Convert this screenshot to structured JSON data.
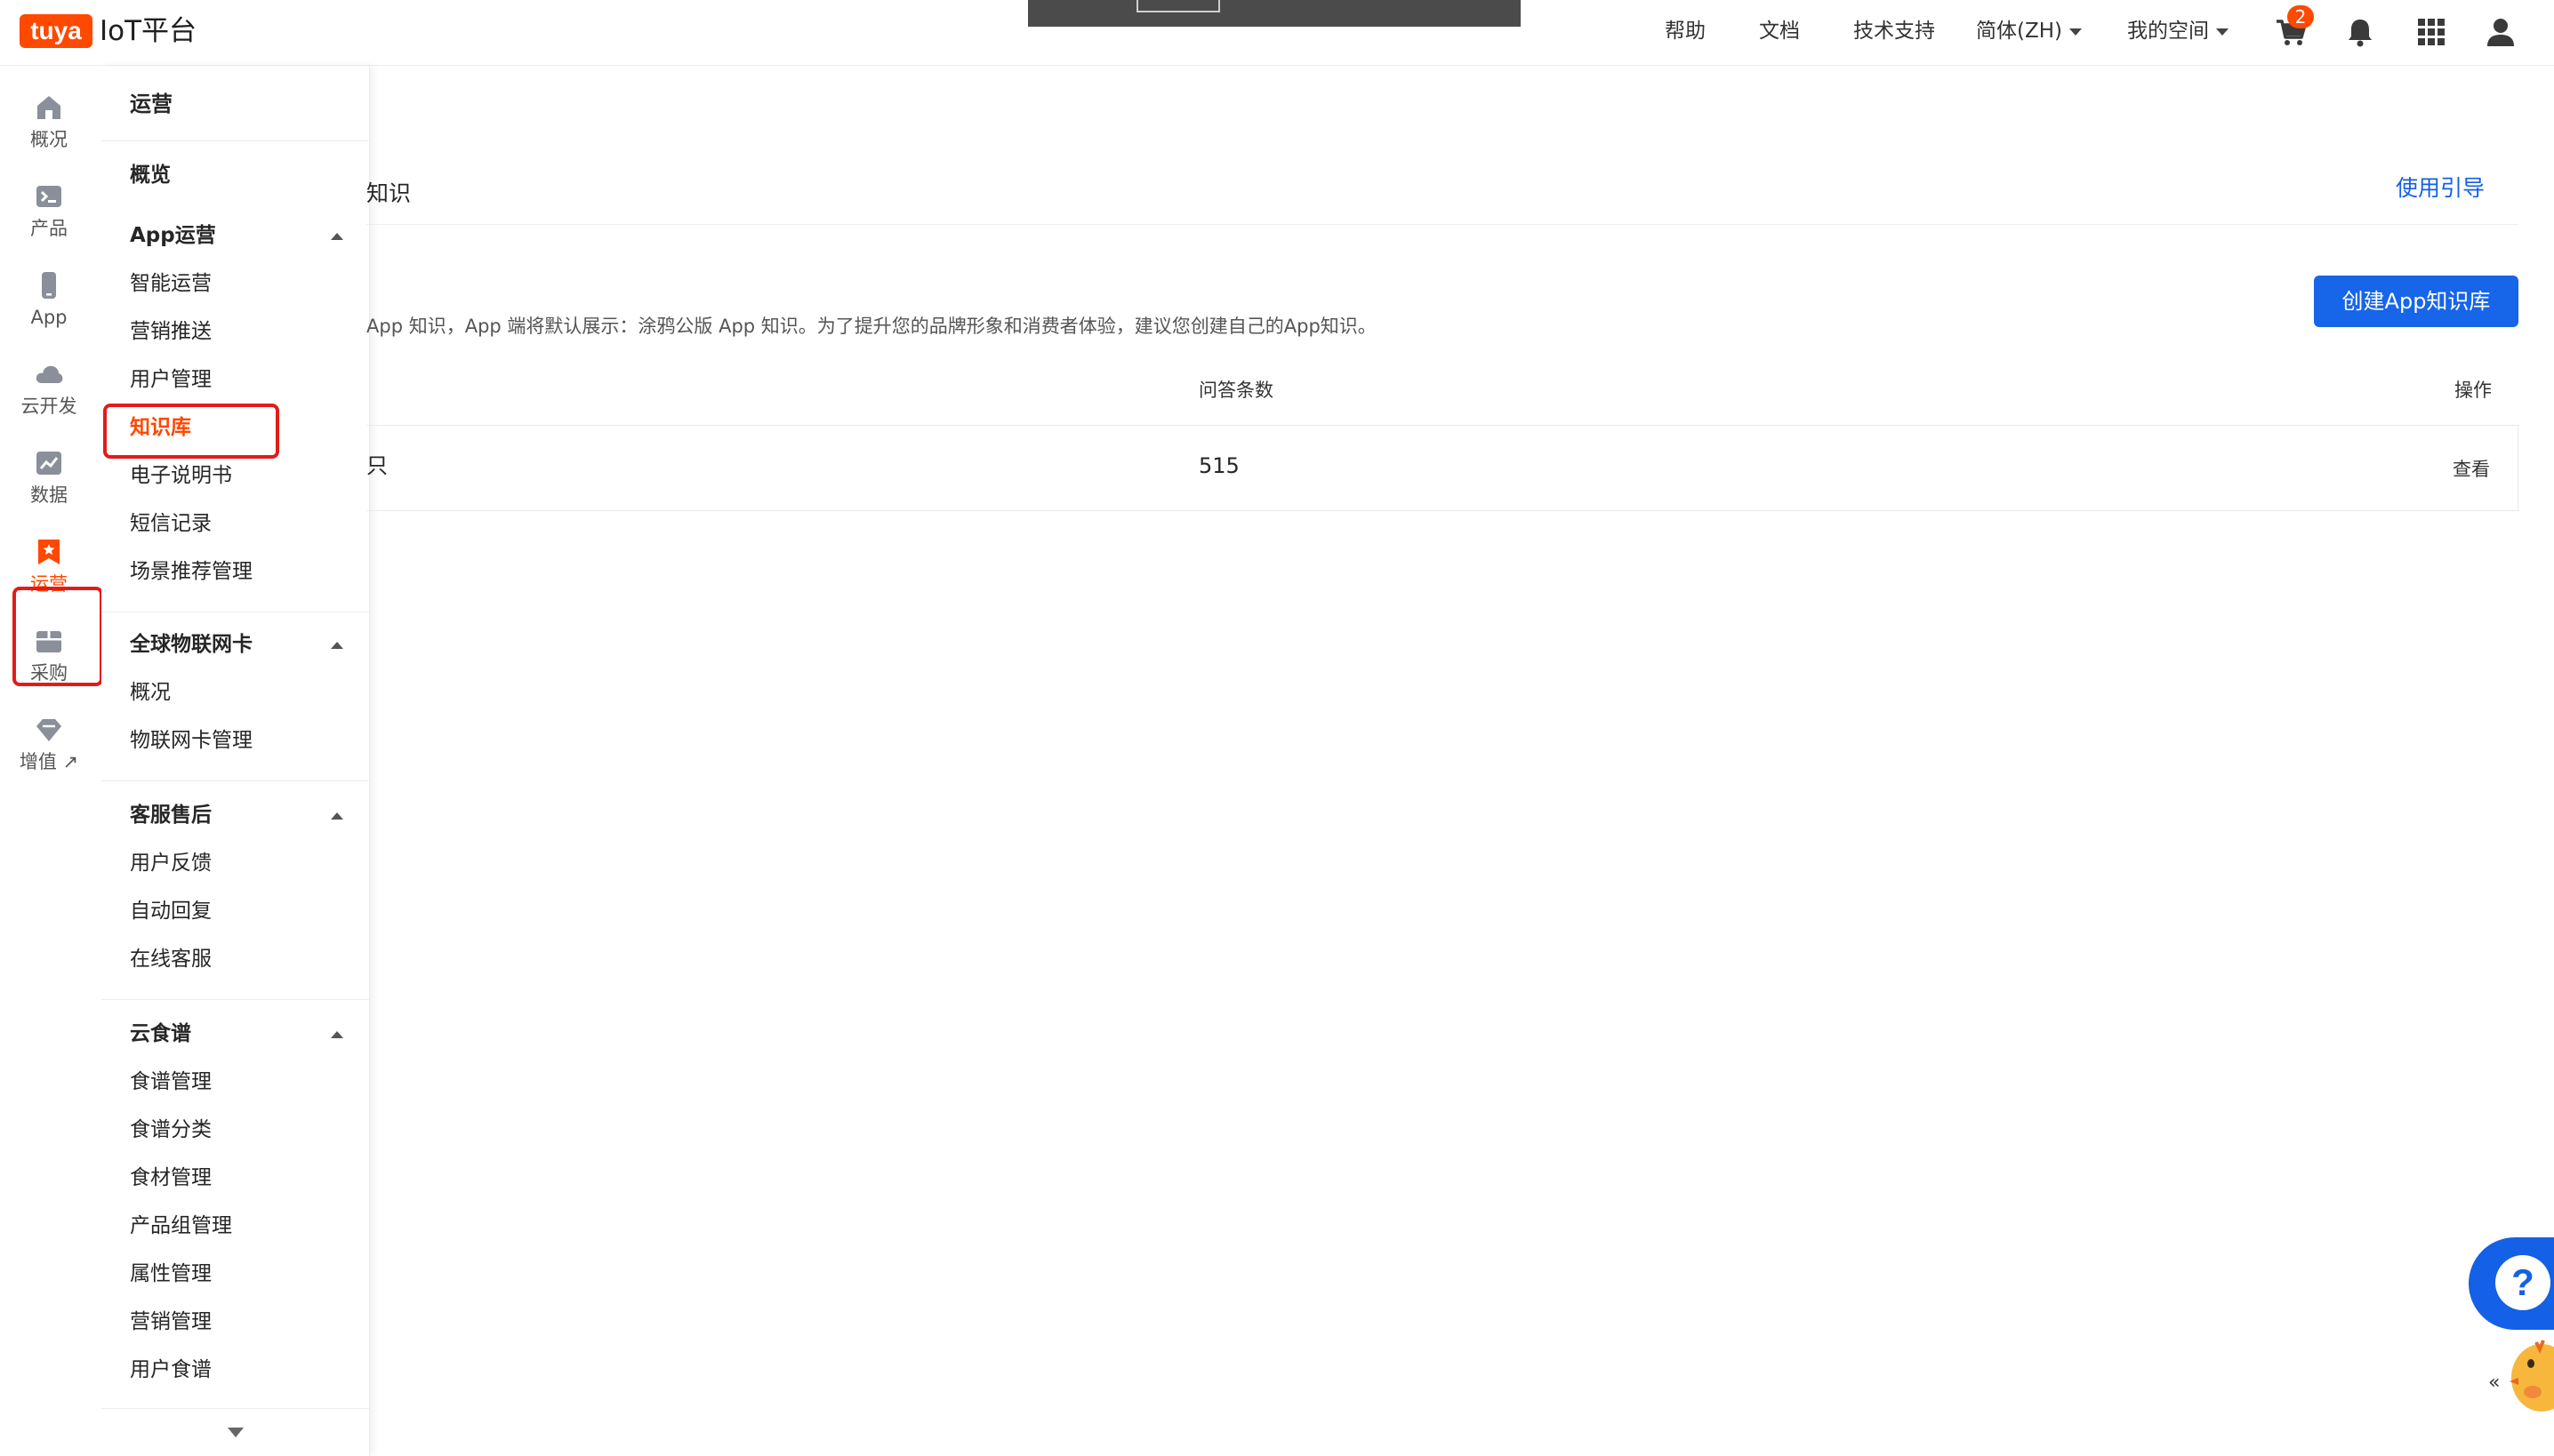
{
  "header": {
    "logo_badge": "tuya",
    "logo_text": "IoT平台",
    "nav": {
      "help": "帮助",
      "docs": "文档",
      "support": "技术支持",
      "language": "简体(ZH)",
      "space": "我的空间"
    },
    "cart_count": "2"
  },
  "rail": {
    "items": [
      {
        "label": "概况",
        "icon": "home-icon"
      },
      {
        "label": "产品",
        "icon": "terminal-icon"
      },
      {
        "label": "App",
        "icon": "phone-icon"
      },
      {
        "label": "云开发",
        "icon": "cloud-icon"
      },
      {
        "label": "数据",
        "icon": "chart-icon"
      },
      {
        "label": "运营",
        "icon": "bookmark-star-icon"
      },
      {
        "label": "采购",
        "icon": "box-icon"
      },
      {
        "label": "增值",
        "icon": "diamond-icon",
        "suffix": "↗"
      }
    ],
    "active_index": 5
  },
  "submenu": {
    "title": "运营",
    "overview": "概览",
    "groups": [
      {
        "label": "App运营",
        "items": [
          "智能运营",
          "营销推送",
          "用户管理",
          "知识库",
          "电子说明书",
          "短信记录",
          "场景推荐管理"
        ]
      },
      {
        "label": "全球物联网卡",
        "items": [
          "概况",
          "物联网卡管理"
        ]
      },
      {
        "label": "客服售后",
        "items": [
          "用户反馈",
          "自动回复",
          "在线客服"
        ]
      },
      {
        "label": "云食谱",
        "items": [
          "食谱管理",
          "食谱分类",
          "食材管理",
          "产品组管理",
          "属性管理",
          "营销管理",
          "用户食谱"
        ]
      }
    ],
    "active_item": "知识库"
  },
  "main": {
    "page_title": "知识",
    "guide_link": "使用引导",
    "description": "App 知识，App 端将默认展示：涂鸦公版 App 知识。为了提升您的品牌形象和消费者体验，建议您创建自己的App知识。",
    "create_button": "创建App知识库",
    "table": {
      "headers": {
        "count": "问答条数",
        "action": "操作"
      },
      "rows": [
        {
          "name": "只",
          "count": "515",
          "action": "查看"
        }
      ]
    }
  },
  "help_fab": "?",
  "colors": {
    "brand_orange": "#ff4800",
    "primary_blue": "#1765e8",
    "highlight_red": "#e31b1b"
  }
}
